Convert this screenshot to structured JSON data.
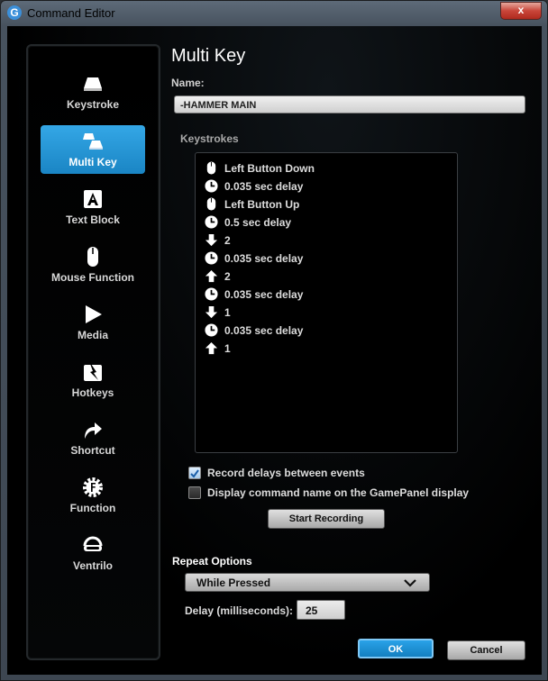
{
  "window": {
    "title": "Command Editor",
    "app_icon_letter": "G",
    "close_label": "x"
  },
  "sidebar": {
    "items": [
      {
        "label": "Keystroke",
        "icon": "keycap-icon"
      },
      {
        "label": "Multi Key",
        "icon": "multi-keycap-icon",
        "active": true
      },
      {
        "label": "Text Block",
        "icon": "text-block-icon"
      },
      {
        "label": "Mouse Function",
        "icon": "mouse-icon"
      },
      {
        "label": "Media",
        "icon": "play-icon"
      },
      {
        "label": "Hotkeys",
        "icon": "hotkey-icon"
      },
      {
        "label": "Shortcut",
        "icon": "shortcut-arrow-icon"
      },
      {
        "label": "Function",
        "icon": "function-gear-icon"
      },
      {
        "label": "Ventrilo",
        "icon": "headset-icon"
      }
    ]
  },
  "main": {
    "title": "Multi Key",
    "name_label": "Name:",
    "name_value": "-HAMMER MAIN",
    "keystrokes_label": "Keystrokes",
    "keystrokes": [
      {
        "icon": "mouse-icon",
        "text": "Left Button Down"
      },
      {
        "icon": "clock-icon",
        "text": "0.035 sec delay"
      },
      {
        "icon": "mouse-icon",
        "text": "Left Button Up"
      },
      {
        "icon": "clock-icon",
        "text": "0.5 sec delay"
      },
      {
        "icon": "arrow-down-icon",
        "text": "2"
      },
      {
        "icon": "clock-icon",
        "text": "0.035 sec delay"
      },
      {
        "icon": "arrow-up-icon",
        "text": "2"
      },
      {
        "icon": "clock-icon",
        "text": "0.035 sec delay"
      },
      {
        "icon": "arrow-down-icon",
        "text": "1"
      },
      {
        "icon": "clock-icon",
        "text": "0.035 sec delay"
      },
      {
        "icon": "arrow-up-icon",
        "text": "1"
      }
    ],
    "record_delays": {
      "label": "Record delays between events",
      "checked": true
    },
    "display_name": {
      "label": "Display command name on the GamePanel display",
      "checked": false
    },
    "start_recording_label": "Start Recording",
    "repeat_options_label": "Repeat Options",
    "repeat_mode": "While Pressed",
    "delay_label": "Delay (milliseconds):",
    "delay_value": "25",
    "ok_label": "OK",
    "cancel_label": "Cancel"
  },
  "colors": {
    "accent": "#1a8fd4",
    "close": "#c9463a"
  }
}
